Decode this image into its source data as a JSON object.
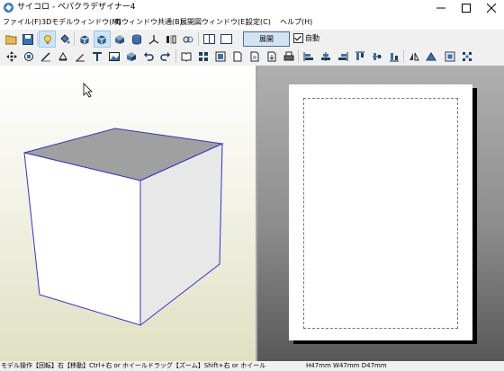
{
  "window": {
    "title": "サイコロ - ペパクラデザイナー4"
  },
  "menu": [
    {
      "label": "ファイル(F)"
    },
    {
      "label": "3Dモデルウィンドウ(M)"
    },
    {
      "label": "両ウィンドウ共通(B)"
    },
    {
      "label": "展開図ウィンドウ(E)"
    },
    {
      "label": "設定(C)"
    },
    {
      "label": "ヘルプ(H)"
    }
  ],
  "toolbar": {
    "unfold_label": "展開",
    "auto_label": "自動",
    "auto_checked": true
  },
  "status": {
    "left": "モデル操作【回転】右【移動】Ctrl+右 or ホイールドラッグ【ズーム】Shift+右 or ホイール",
    "right": "H47mm W47mm D47mm"
  },
  "colors": {
    "cube_top": "#a0a0a0",
    "cube_front": "#ffffff",
    "cube_side": "#e8e8e8",
    "cube_edge": "#3333cc",
    "active_tool": "#cce4f7"
  }
}
